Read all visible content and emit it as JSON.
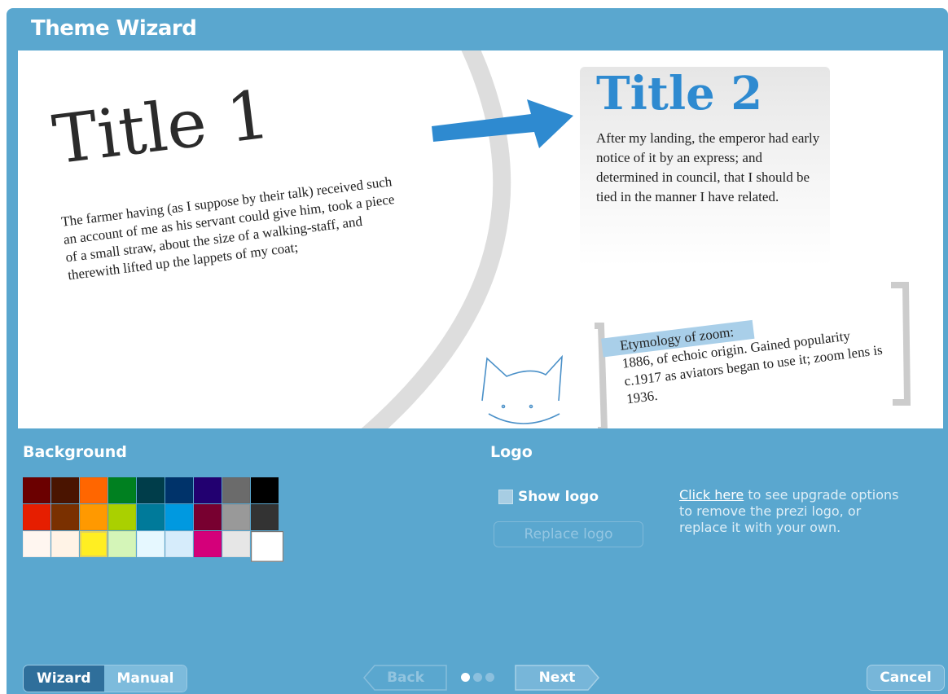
{
  "window": {
    "title": "Theme Wizard"
  },
  "preview": {
    "title1": "Title 1",
    "paragraph1": "The farmer having (as I suppose by their talk) received such an account of me as his servant could give him, took a piece of a small straw, about the size of a walking-staff, and therewith lifted up the lappets of my coat;",
    "title2": "Title 2",
    "paragraph2": "After my landing, the emperor had early notice of it by an express; and determined in council, that I should be tied in the manner I have related.",
    "note_line1": "Etymology of zoom:",
    "note_rest": "1886, of echoic origin. Gained popularity c.1917 as aviators began to use it; zoom lens is 1936.",
    "title1_color": "#2b2b2b",
    "title2_color": "#2e8ad0",
    "arrow_color": "#2e8ad0",
    "doodle_color": "#4a90c8"
  },
  "background_section": {
    "heading": "Background",
    "swatches": [
      [
        "#6b0000",
        "#4a1400",
        "#ff6600",
        "#008020",
        "#003d4a",
        "#00336a",
        "#220070",
        "#6b6b6b",
        "#000000"
      ],
      [
        "#e61e00",
        "#7a3000",
        "#ff9900",
        "#aad000",
        "#007a9a",
        "#0099e0",
        "#780030",
        "#999999",
        "#333333"
      ],
      [
        "#fff6f0",
        "#fff3e6",
        "#ffee22",
        "#d4f5b8",
        "#e6f8ff",
        "#d6ecfb",
        "#d4007a",
        "#e6e6e6",
        "#ffffff"
      ]
    ],
    "selected_swatch": "#ffee22"
  },
  "logo_section": {
    "heading": "Logo",
    "show_logo_label": "Show logo",
    "replace_logo_label": "Replace logo",
    "upgrade_link": "Click here",
    "upgrade_text": " to see upgrade options to remove the prezi logo, or replace it with your own."
  },
  "footer": {
    "wizard_label": "Wizard",
    "manual_label": "Manual",
    "back_label": "Back",
    "next_label": "Next",
    "cancel_label": "Cancel",
    "step": 1,
    "total_steps": 3
  },
  "colors": {
    "frame": "#5aa7cf",
    "active_toggle": "#2f6f9b"
  }
}
